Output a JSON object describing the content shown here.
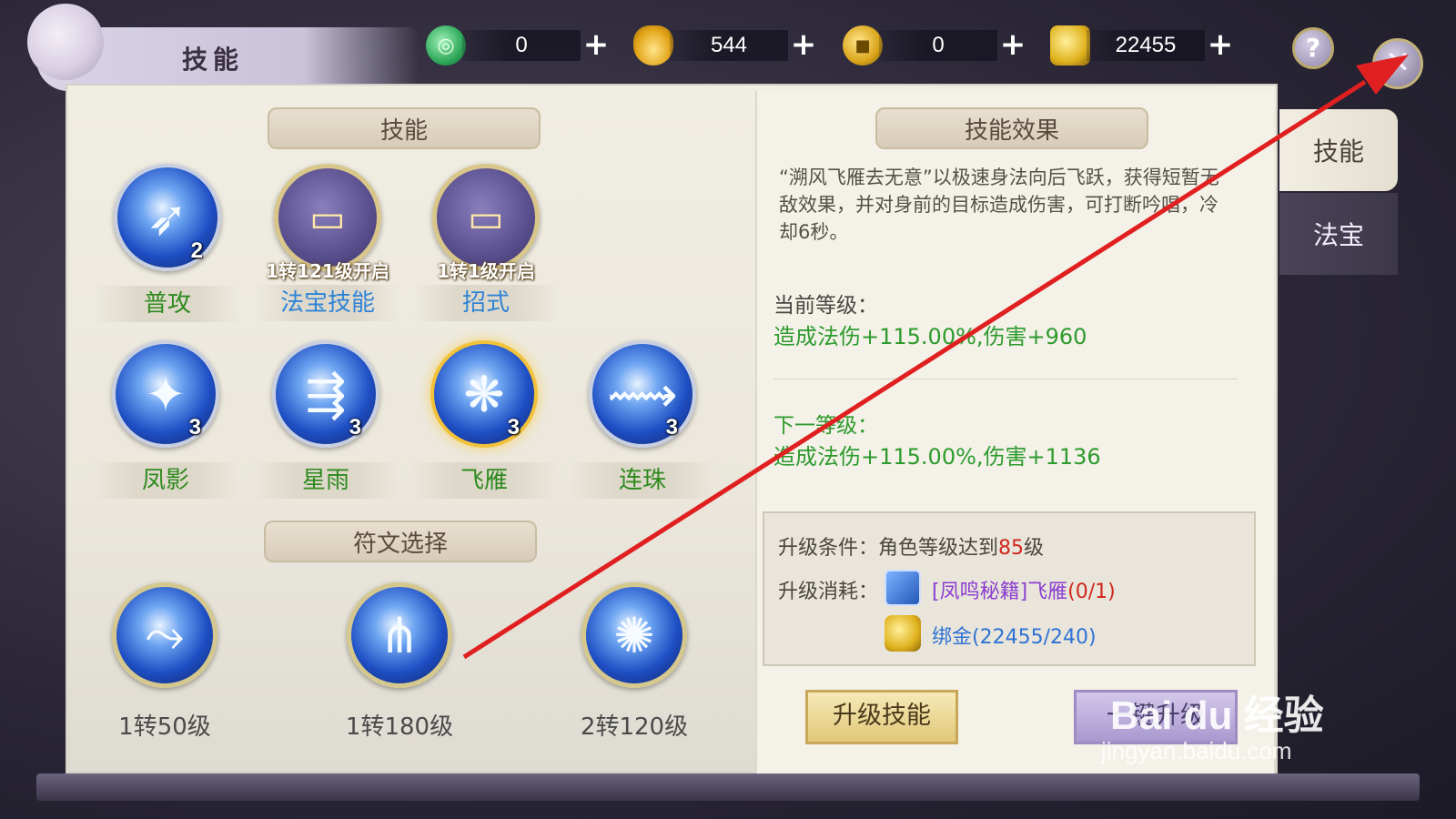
{
  "window": {
    "title": "技能"
  },
  "currencies": [
    {
      "icon": "jade-icon",
      "value": "0"
    },
    {
      "icon": "gold-ingot-icon",
      "value": "544"
    },
    {
      "icon": "coin-icon",
      "value": "0"
    },
    {
      "icon": "bound-gold-icon",
      "value": "22455"
    }
  ],
  "buttons": {
    "help": "?",
    "close": "✕",
    "plus": "+"
  },
  "skills_section": {
    "header": "技能",
    "row1": [
      {
        "name": "普攻",
        "level": "2"
      },
      {
        "name": "法宝技能",
        "note": "1转121级开启"
      },
      {
        "name": "招式",
        "note": "1转1级开启"
      }
    ],
    "row2": [
      {
        "name": "凤影",
        "level": "3"
      },
      {
        "name": "星雨",
        "level": "3"
      },
      {
        "name": "飞雁",
        "level": "3"
      },
      {
        "name": "连珠",
        "level": "3"
      }
    ]
  },
  "runes_section": {
    "header": "符文选择",
    "runes": [
      {
        "label": "1转50级"
      },
      {
        "label": "1转180级"
      },
      {
        "label": "2转120级"
      }
    ]
  },
  "effect_section": {
    "header": "技能效果",
    "description": "“溯风飞雁去无意”以极速身法向后飞跃，获得短暂无敌效果，并对身前的目标造成伤害，可打断吟唱，冷却6秒。",
    "current_title": "当前等级：",
    "current_value": "造成法伤+115.00%,伤害+960",
    "next_title": "下一等级：",
    "next_value": "造成法伤+115.00%,伤害+1136",
    "condition_label": "升级条件：",
    "condition_text": "角色等级达到",
    "condition_level": "85",
    "condition_suffix": "级",
    "cost_label": "升级消耗：",
    "cost_item": "[凤鸣秘籍]飞雁",
    "cost_item_count": "(0/1)",
    "cost_gold": "绑金(22455/240)"
  },
  "action_buttons": {
    "upgrade": "升级技能",
    "one_click": "一键升级"
  },
  "side_tabs": [
    {
      "label": "技能"
    },
    {
      "label": "法宝"
    }
  ],
  "watermark": {
    "logo": "Bai du 经验",
    "url": "jingyan.baidu.com"
  },
  "colors": {
    "accent_green": "#2e9b2e",
    "accent_red": "#d1261d",
    "arrow": "#e02020"
  }
}
